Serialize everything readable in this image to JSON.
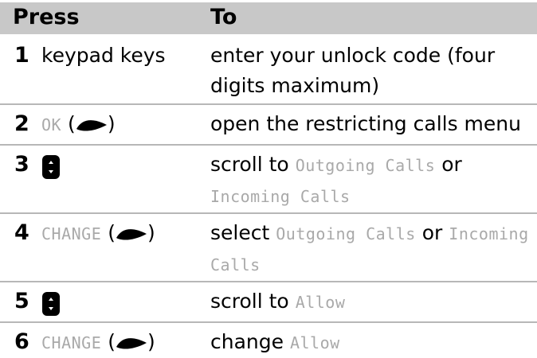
{
  "header": {
    "press": "Press",
    "to": "To"
  },
  "rows": [
    {
      "num": "1",
      "press": "keypad keys",
      "action": "enter your unlock code (four digits maximum)"
    },
    {
      "num": "2",
      "press_key": "OK",
      "action": "open the restricting calls menu"
    },
    {
      "num": "3",
      "action_pre": "scroll to ",
      "opt1": "Outgoing Calls",
      "mid": " or ",
      "opt2": "Incoming Calls"
    },
    {
      "num": "4",
      "press_key": "CHANGE",
      "action_pre": "select ",
      "opt1": "Outgoing Calls",
      "mid": " or ",
      "opt2": "Incoming Calls"
    },
    {
      "num": "5",
      "action_pre": "scroll to ",
      "opt1": "Allow"
    },
    {
      "num": "6",
      "press_key": "CHANGE",
      "action_pre": "change ",
      "opt1": "Allow"
    }
  ],
  "icons": {
    "softkey": "right-soft-key-icon",
    "navkey": "navigation-key-icon"
  }
}
